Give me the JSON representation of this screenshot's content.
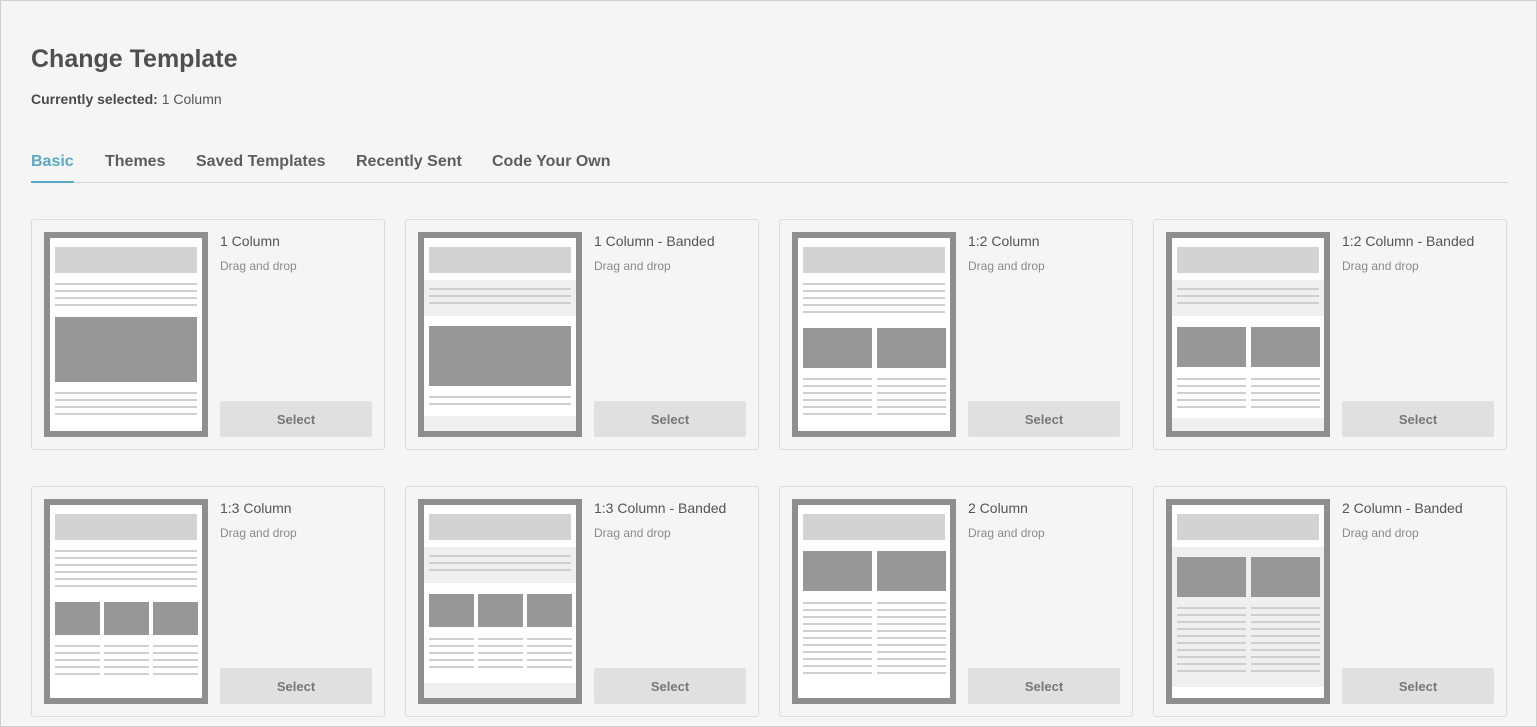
{
  "page": {
    "title": "Change Template",
    "selected_label": "Currently selected:",
    "selected_value": "1 Column"
  },
  "tabs": [
    {
      "label": "Basic",
      "active": true
    },
    {
      "label": "Themes",
      "active": false
    },
    {
      "label": "Saved Templates",
      "active": false
    },
    {
      "label": "Recently Sent",
      "active": false
    },
    {
      "label": "Code Your Own",
      "active": false
    }
  ],
  "templates": [
    {
      "name": "1 Column",
      "subtitle": "Drag and drop",
      "button": "Select",
      "layout": "one-column"
    },
    {
      "name": "1 Column - Banded",
      "subtitle": "Drag and drop",
      "button": "Select",
      "layout": "one-column-banded"
    },
    {
      "name": "1:2 Column",
      "subtitle": "Drag and drop",
      "button": "Select",
      "layout": "one-two-column"
    },
    {
      "name": "1:2 Column - Banded",
      "subtitle": "Drag and drop",
      "button": "Select",
      "layout": "one-two-column-banded"
    },
    {
      "name": "1:3 Column",
      "subtitle": "Drag and drop",
      "button": "Select",
      "layout": "one-three-column"
    },
    {
      "name": "1:3 Column - Banded",
      "subtitle": "Drag and drop",
      "button": "Select",
      "layout": "one-three-column-banded"
    },
    {
      "name": "2 Column",
      "subtitle": "Drag and drop",
      "button": "Select",
      "layout": "two-column"
    },
    {
      "name": "2 Column - Banded",
      "subtitle": "Drag and drop",
      "button": "Select",
      "layout": "two-column-banded"
    }
  ],
  "colors": {
    "accent": "#5aa9c4",
    "thumb_frame": "#8e8e8e",
    "thumb_block": "#979797",
    "thumb_header": "#d3d3d3",
    "button_bg": "#e0e0e0"
  }
}
